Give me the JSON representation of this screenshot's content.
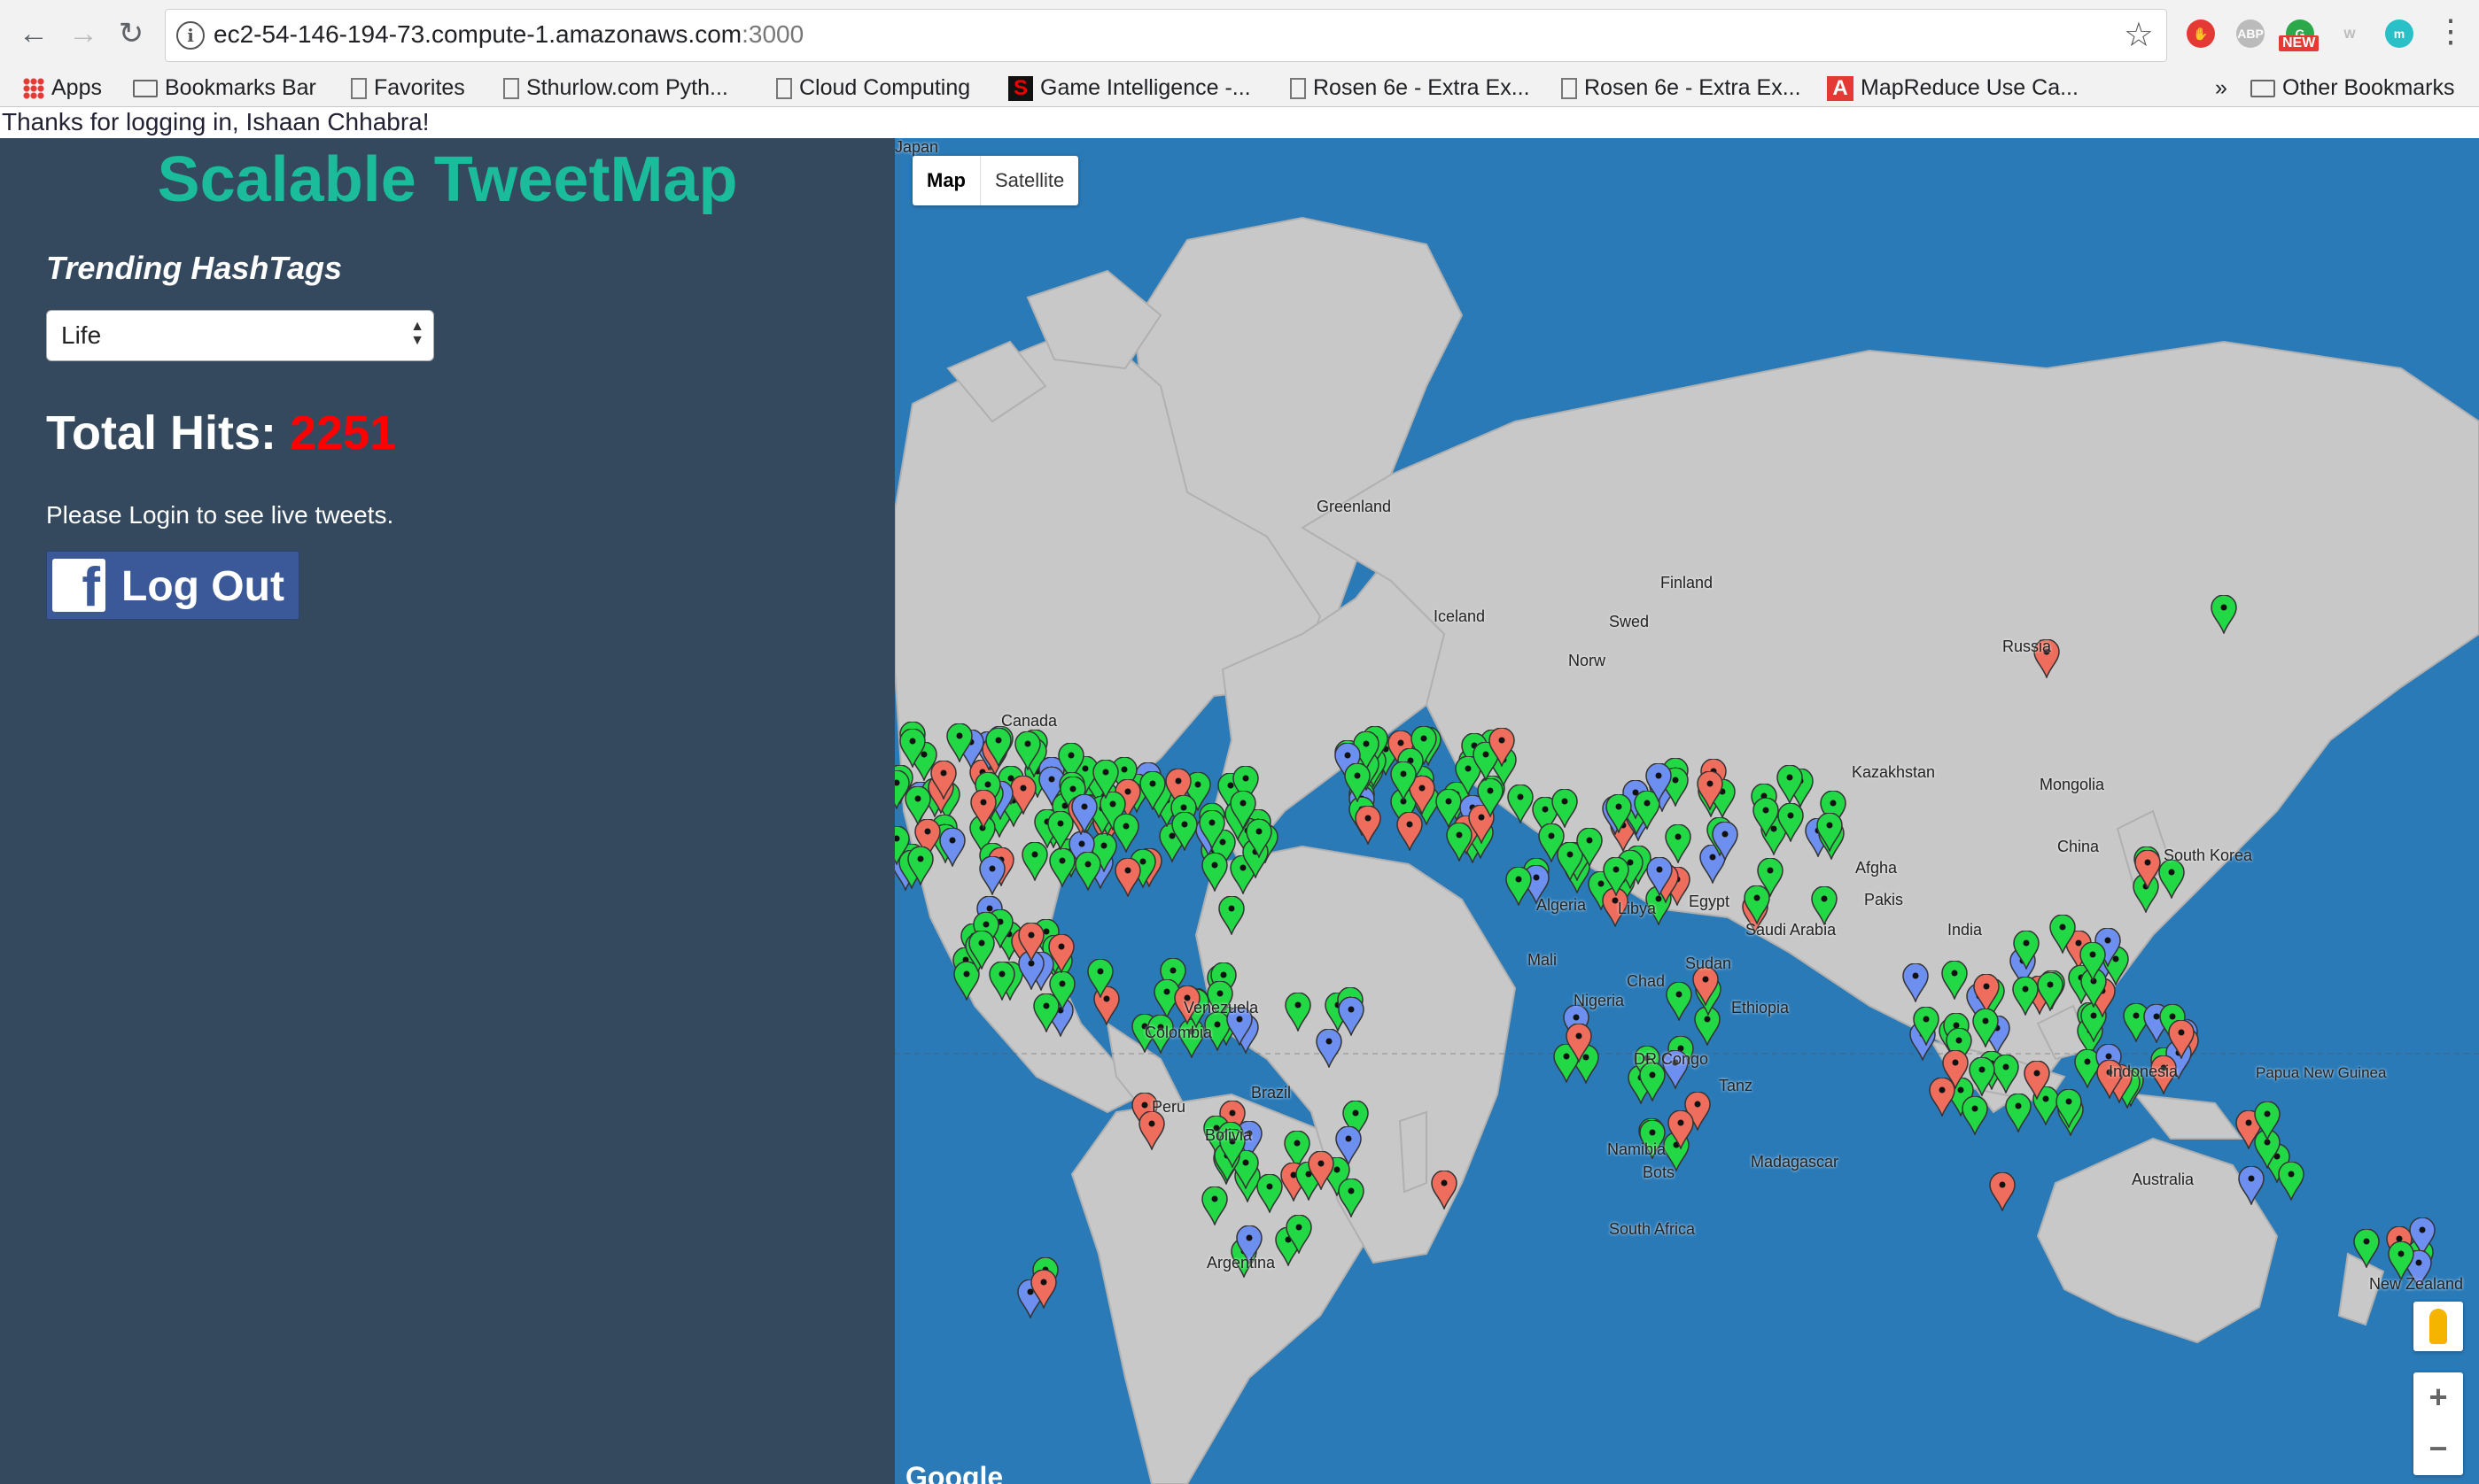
{
  "browser": {
    "url_host": "ec2-54-146-194-73.compute-1.amazonaws.com",
    "url_port": ":3000",
    "bookmarks": [
      {
        "label": "Apps",
        "icon": "apps-icon"
      },
      {
        "label": "Bookmarks Bar",
        "icon": "folder-icon"
      },
      {
        "label": "Favorites",
        "icon": "page-icon"
      },
      {
        "label": "Sthurlow.com Pyth...",
        "icon": "page-icon"
      },
      {
        "label": "Cloud Computing",
        "icon": "page-icon"
      },
      {
        "label": "Game Intelligence -...",
        "icon": "s-logo-icon"
      },
      {
        "label": "Rosen 6e - Extra Ex...",
        "icon": "page-icon"
      },
      {
        "label": "Rosen 6e - Extra Ex...",
        "icon": "page-icon"
      },
      {
        "label": "MapReduce Use Ca...",
        "icon": "a-logo-icon"
      }
    ],
    "overflow": "»",
    "other_bookmarks": "Other Bookmarks",
    "ext_badge": "NEW"
  },
  "page": {
    "login_message": "Thanks for logging in, Ishaan Chhabra!",
    "title": "Scalable TweetMap",
    "trending_label": "Trending HashTags",
    "selected_hashtag": "Life",
    "total_hits_label": "Total Hits:",
    "total_hits_value": "2251",
    "login_note": "Please Login to see live tweets.",
    "logout_label": "Log Out"
  },
  "map": {
    "type_options": [
      "Map",
      "Satellite"
    ],
    "active_type": "Map",
    "labels": [
      "Greenland",
      "Iceland",
      "Finland",
      "Russia",
      "Norw",
      "Swed",
      "Kazakhstan",
      "Mongolia",
      "China",
      "Algeria",
      "Libya",
      "Egypt",
      "Mali",
      "Chad",
      "Sudan",
      "Ethiopia",
      "DR Congo",
      "Tanz",
      "Namibia",
      "Bots",
      "South Africa",
      "Madagascar",
      "Venezuela",
      "Colombia",
      "Peru",
      "Brazil",
      "Bolivia",
      "Argentina",
      "Canada",
      "Australia",
      "Papua New Guinea",
      "New Zealand",
      "Afgha",
      "Pakis",
      "Saudi Arabia",
      "South Korea",
      "Japan",
      "Indonesia",
      "Nigeria",
      "India"
    ],
    "zoom_in": "+",
    "zoom_out": "−",
    "attribution": "Google",
    "pin_colors": {
      "green": "#22d845",
      "red": "#ee6d5d",
      "blue": "#6d8ff0"
    }
  }
}
